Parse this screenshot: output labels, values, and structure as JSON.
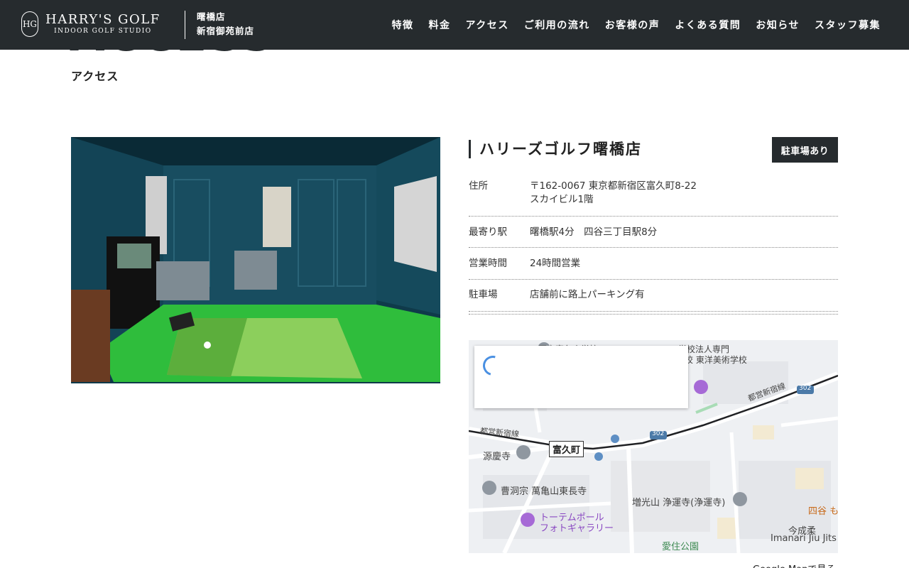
{
  "header": {
    "logo_name": "HARRY'S GOLF",
    "logo_sub": "INDOOR GOLF STUDIO",
    "logo_mark": "HG",
    "store_line1": "曙橋店",
    "store_line2": "新宿御苑前店",
    "nav": [
      "特徴",
      "料金",
      "アクセス",
      "ご利用の流れ",
      "お客様の声",
      "よくある質問",
      "お知らせ",
      "スタッフ募集"
    ]
  },
  "page": {
    "heading": "ACCESS",
    "subheading": "アクセス"
  },
  "store": {
    "title": "ハリーズゴルフ曙橋店",
    "parking_badge": "駐車場あり",
    "rows": [
      {
        "label": "住所",
        "value_line1": "〒162-0067 東京都新宿区富久町8-22",
        "value_line2": "スカイビル1階"
      },
      {
        "label": "最寄り駅",
        "value_line1": "曙橋駅4分　四谷三丁目駅8分"
      },
      {
        "label": "営業時間",
        "value_line1": "24時間営業"
      },
      {
        "label": "駐車場",
        "value_line1": "店舗前に路上パーキング有"
      }
    ]
  },
  "map": {
    "labels": {
      "school1": "区立富久小学校",
      "school2a": "学校法人専門",
      "school2b": "学校 東洋美術学校",
      "road1": "都営新宿線",
      "road2": "都営新宿線",
      "route302a": "302",
      "route302b": "302",
      "tomikucho": "富久町",
      "genkeiji": "源慶寺",
      "tochoji": "曹洞宗 萬亀山東長寺",
      "jounenji": "増光山 浄運寺(浄運寺)",
      "totem1": "トーテムポール",
      "totem2": "フォトギャラリー",
      "yotsuya": "四谷 も",
      "imanari1": "今成柔",
      "imanari2": "Imanari Jiu Jits",
      "aizumi": "愛住公園"
    },
    "link": "Google Mapで見る"
  }
}
